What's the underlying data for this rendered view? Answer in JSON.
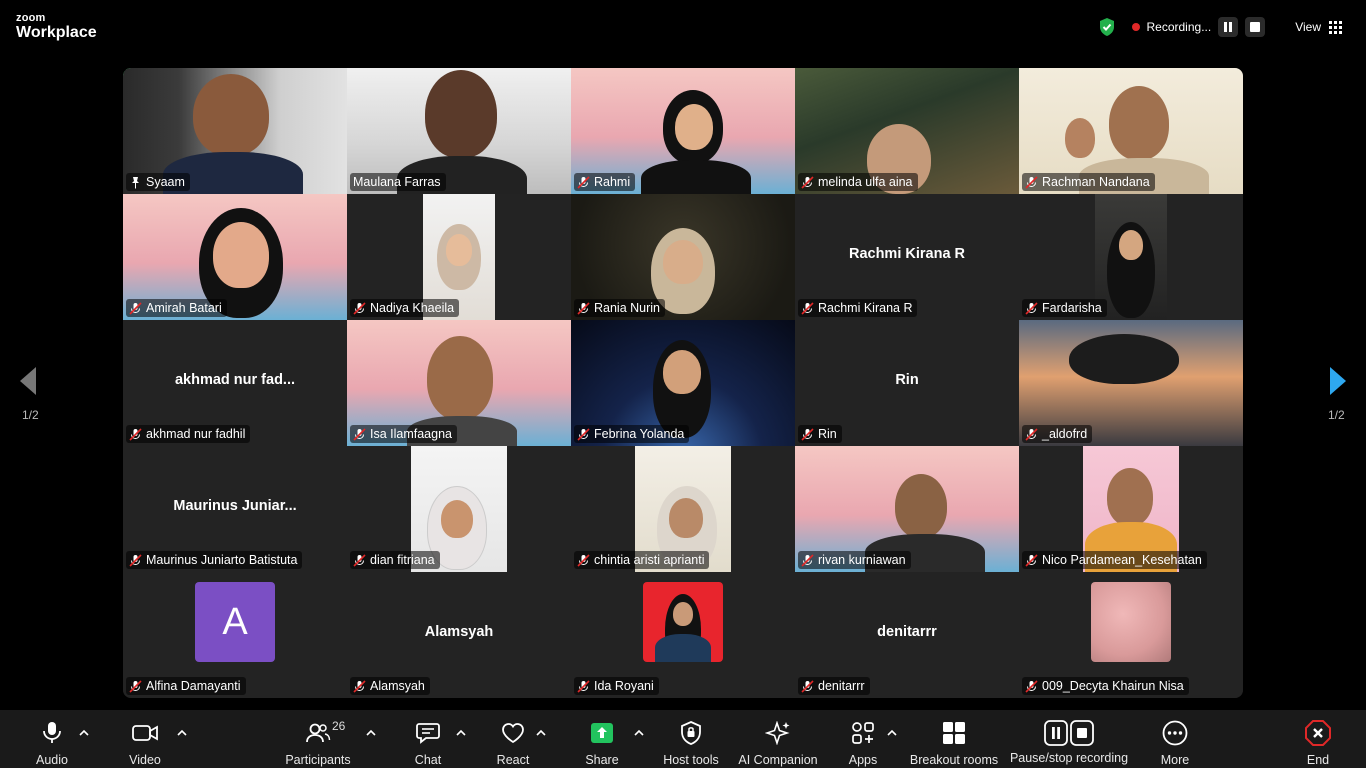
{
  "app": {
    "logo_line1": "zoom",
    "logo_line2": "Workplace"
  },
  "topbar": {
    "recording_label": "Recording...",
    "view_label": "View"
  },
  "navigation": {
    "page_left": "1/2",
    "page_right": "1/2"
  },
  "participants": [
    {
      "name": "Syaam",
      "pinned": true,
      "muted": false,
      "video": true
    },
    {
      "name": "Maulana Farras",
      "muted": false,
      "video": true
    },
    {
      "name": "Rahmi",
      "muted": true,
      "video": true,
      "background": "banner"
    },
    {
      "name": "melinda ulfa aina",
      "muted": true,
      "video": true
    },
    {
      "name": "Rachman Nandana",
      "muted": true,
      "video": true
    },
    {
      "name": "Amirah Batari",
      "muted": true,
      "video": true,
      "background": "banner"
    },
    {
      "name": "Nadiya Khaeila",
      "muted": true,
      "video": true
    },
    {
      "name": "Rania Nurin",
      "muted": true,
      "video": true
    },
    {
      "name": "Rachmi Kirana R",
      "display": "Rachmi Kirana R",
      "muted": true,
      "video": false
    },
    {
      "name": "Fardarisha",
      "muted": true,
      "video": true
    },
    {
      "name": "akhmad nur fadhil",
      "display": "akhmad nur fad...",
      "muted": true,
      "video": false
    },
    {
      "name": "Isa Ilamfaagna",
      "muted": true,
      "video": true,
      "background": "banner"
    },
    {
      "name": "Febrina Yolanda",
      "muted": true,
      "video": true
    },
    {
      "name": "Rin",
      "display": "Rin",
      "muted": true,
      "video": false
    },
    {
      "name": "_aldofrd",
      "muted": true,
      "video": true
    },
    {
      "name": "Maurinus Juniarto Batistuta",
      "display": "Maurinus Juniar...",
      "muted": true,
      "video": false
    },
    {
      "name": "dian fitriana",
      "muted": true,
      "video": true
    },
    {
      "name": "chintia aristi aprianti",
      "muted": true,
      "video": true
    },
    {
      "name": "rivan kurniawan",
      "muted": true,
      "video": true,
      "background": "banner"
    },
    {
      "name": "Nico Pardamean_Kesehatan",
      "muted": true,
      "video": true
    },
    {
      "name": "Alfina Damayanti",
      "avatar_letter": "A",
      "muted": true,
      "video": false,
      "avatar_color": "#7b4fc4"
    },
    {
      "name": "Alamsyah",
      "display": "Alamsyah",
      "muted": true,
      "video": false
    },
    {
      "name": "Ida Royani",
      "muted": true,
      "video": false,
      "avatar_color": "#e8252d"
    },
    {
      "name": "denitarrr",
      "display": "denitarrr",
      "muted": true,
      "video": false
    },
    {
      "name": "009_Decyta Khairun Nisa",
      "muted": true,
      "video": false,
      "avatar_color": "#d99a9a"
    }
  ],
  "toolbar": {
    "audio": "Audio",
    "video": "Video",
    "participants": "Participants",
    "participants_count": "26",
    "chat": "Chat",
    "react": "React",
    "share": "Share",
    "host_tools": "Host tools",
    "ai_companion": "AI Companion",
    "apps": "Apps",
    "breakout_rooms": "Breakout rooms",
    "pause_recording": "Pause/stop recording",
    "more": "More",
    "end": "End"
  },
  "colors": {
    "active_speaker": "#2fd46b",
    "share_green": "#22c35e",
    "end_red": "#e02828",
    "nav_arrow_blue": "#2ea8f0"
  }
}
